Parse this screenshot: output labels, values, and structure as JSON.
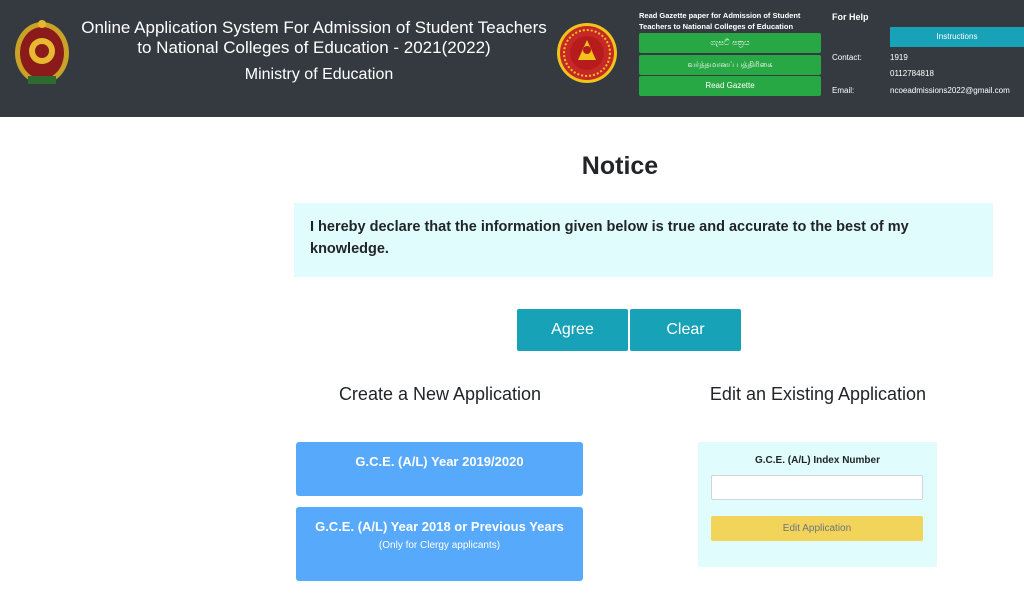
{
  "header": {
    "title": "Online Application System For Admission of Student Teachers to National Colleges of Education - 2021(2022)",
    "ministry": "Ministry of Education",
    "gazette": {
      "heading": "Read Gazette paper for Admission of Student Teachers to National Colleges of Education",
      "btn_sinhala": "ගැසට් පත්‍රය",
      "btn_tamil": "வர்த்தமானப் பத்திரிகை",
      "btn_read": "Read Gazette"
    },
    "help": {
      "title": "For Help",
      "instructions_label": "Instructions",
      "contact_label": "Contact:",
      "contact_1": "1919",
      "contact_2": "0112784818",
      "email_label": "Email:",
      "email": "ncoeadmissions2022@gmail.com"
    }
  },
  "notice": {
    "title": "Notice",
    "declaration": "I hereby declare that the information given below is true and accurate to the best of my knowledge.",
    "agree_label": "Agree",
    "clear_label": "Clear"
  },
  "create": {
    "title": "Create a New Application",
    "option_1": "G.C.E. (A/L) Year 2019/2020",
    "option_2": "G.C.E. (A/L) Year 2018 or Previous Years",
    "option_2_note": "(Only for Clergy applicants)"
  },
  "edit": {
    "title": "Edit an Existing Application",
    "index_label": "G.C.E. (A/L) Index Number",
    "index_value": "",
    "button_label": "Edit Application"
  },
  "colors": {
    "header_bg": "#343a40",
    "gazette_green": "#28a745",
    "info_teal": "#17a2b8",
    "app_blue": "#57a9fc",
    "edit_yellow": "#f3d45b",
    "panel_cyan": "#e0fcfc"
  }
}
